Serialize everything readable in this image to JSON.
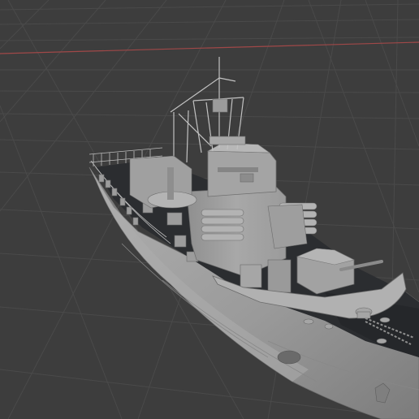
{
  "viewport": {
    "background_color": "#3d3d3d",
    "grid_color": "#4a4a4a",
    "x_axis_color": "#a04848",
    "model_base_color": "#9a9a9a",
    "deck_color": "#2b2d30",
    "view": "perspective"
  },
  "model": {
    "subject": "ship"
  }
}
